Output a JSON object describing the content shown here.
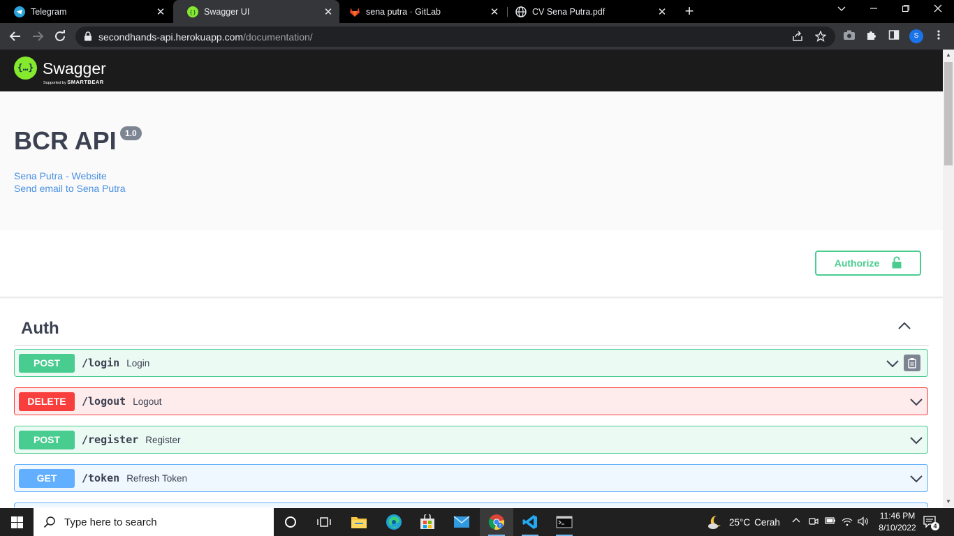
{
  "browser": {
    "tabs": [
      {
        "title": "Telegram",
        "icon": "telegram-icon",
        "active": false
      },
      {
        "title": "Swagger UI",
        "icon": "swagger-icon",
        "active": true
      },
      {
        "title": "sena putra · GitLab",
        "icon": "gitlab-icon",
        "active": false
      },
      {
        "title": "CV Sena Putra.pdf",
        "icon": "globe-icon",
        "active": false
      }
    ],
    "address": {
      "host": "secondhands-api.herokuapp.com",
      "path": "/documentation/"
    },
    "profile_initial": "S"
  },
  "swagger": {
    "brand": "Swagger",
    "brand_logo_glyph": "{…}",
    "supported_by": "Supported by",
    "supported_by_brand": "SMARTBEAR"
  },
  "info": {
    "title": "BCR API",
    "version": "1.0",
    "links": [
      "Sena Putra - Website",
      "Send email to Sena Putra"
    ]
  },
  "authorize_label": "Authorize",
  "auth": {
    "title": "Auth",
    "operations": [
      {
        "method": "POST",
        "path": "/login",
        "summary": "Login"
      },
      {
        "method": "DELETE",
        "path": "/logout",
        "summary": "Logout"
      },
      {
        "method": "POST",
        "path": "/register",
        "summary": "Register"
      },
      {
        "method": "GET",
        "path": "/token",
        "summary": "Refresh Token"
      }
    ]
  },
  "taskbar": {
    "search_placeholder": "Type here to search",
    "weather_temp": "25°C",
    "weather_desc": "Cerah",
    "time": "11:46 PM",
    "date": "8/10/2022",
    "notification_count": "4"
  },
  "colors": {
    "post": "#49cc90",
    "delete": "#f93e3e",
    "get": "#61affe",
    "swagger_topbar": "#1b1b1b",
    "swagger_logo": "#85ea2d"
  }
}
